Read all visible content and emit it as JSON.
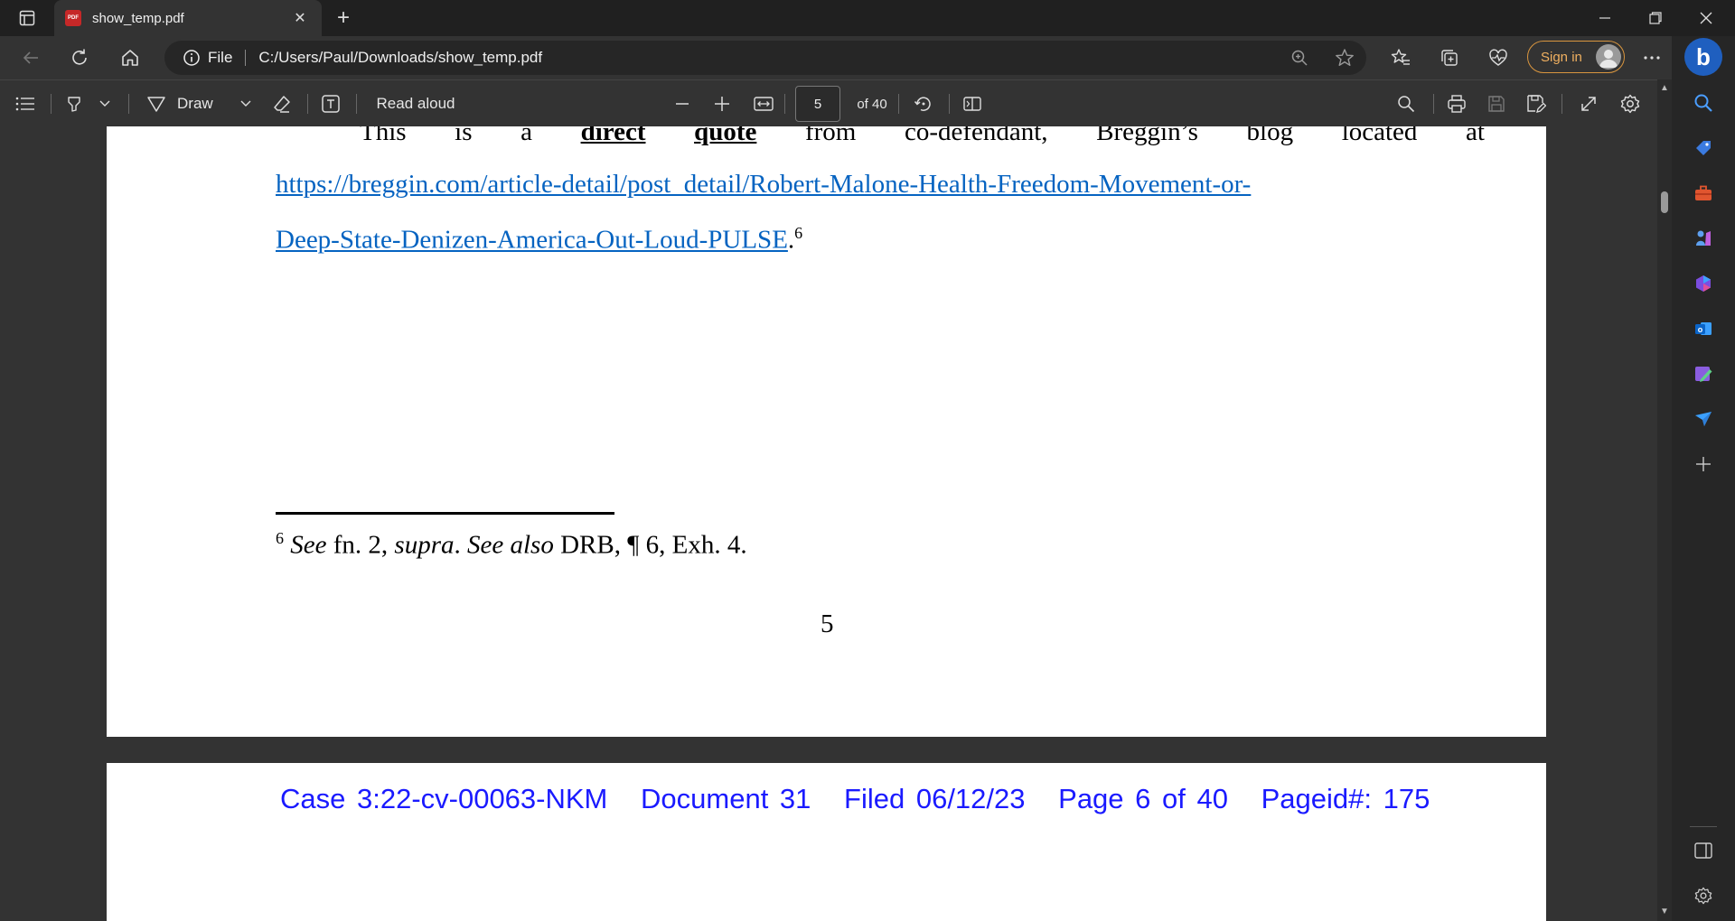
{
  "browser": {
    "tab_title": "show_temp.pdf",
    "address_label": "File",
    "url": "C:/Users/Paul/Downloads/show_temp.pdf",
    "sign_in": "Sign in"
  },
  "pdf_toolbar": {
    "draw_label": "Draw",
    "read_aloud_label": "Read aloud",
    "current_page": "5",
    "page_total": "of 40"
  },
  "document": {
    "line1_words": [
      "This",
      "is",
      "a",
      "direct",
      "quote",
      "from",
      "co-defendant,",
      "Breggin’s",
      "blog",
      "located",
      "at"
    ],
    "link_line1": "https://breggin.com/article-detail/post_detail/Robert-Malone-Health-Freedom-Movement-or-",
    "link_line2": "Deep-State-Denizen-America-Out-Loud-PULSE",
    "link_end": ".",
    "link_footnote_ref": "6",
    "footnote_num": "6",
    "footnote_see": "See",
    "footnote_text1": " fn. 2, ",
    "footnote_supra": "supra",
    "footnote_text2": ". ",
    "footnote_see_also": "See also",
    "footnote_text3": " DRB, ¶ 6, Exh. 4.",
    "page_number": "5",
    "next_page_header": {
      "case": "Case 3:22-cv-00063-NKM",
      "document": "Document 31",
      "filed": "Filed 06/12/23",
      "page": "Page 6 of 40",
      "pageid": "Pageid#: 175"
    }
  },
  "colors": {
    "link": "#0563c1",
    "header_blue": "#1a1aff",
    "signin_accent": "#d9963f"
  }
}
